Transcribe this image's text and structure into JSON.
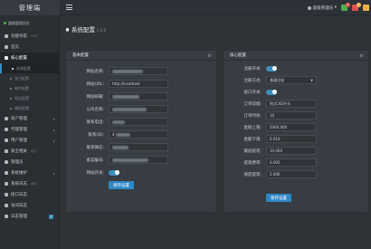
{
  "app": {
    "logo_text": "管理端"
  },
  "topbar": {
    "admin_label": "超级管理员",
    "admin_caret": "▾",
    "icons": [
      {
        "name": "bell-icon",
        "color": "#4cae4c",
        "badge": "2"
      },
      {
        "name": "message-icon",
        "color": "#d9534f",
        "badge": "4"
      },
      {
        "name": "user-icon",
        "color": "#f0ad4e",
        "badge": ""
      }
    ]
  },
  "sidebar": {
    "user_status": "超级管理员在",
    "items": [
      {
        "label": "功能导航",
        "tag": "HOT",
        "type": "section"
      },
      {
        "label": "首页",
        "type": "item"
      },
      {
        "label": "核心配置",
        "type": "item",
        "active": true
      },
      {
        "label": "系统配置",
        "type": "child",
        "selected": true
      },
      {
        "label": "支付配置",
        "type": "child"
      },
      {
        "label": "邮件配置",
        "type": "child"
      },
      {
        "label": "短信配置",
        "type": "child"
      },
      {
        "label": "模板配置",
        "type": "child"
      },
      {
        "label": "商户管理",
        "type": "item",
        "caret": "▸"
      },
      {
        "label": "代理管理",
        "type": "item",
        "caret": "▸"
      },
      {
        "label": "用户管理",
        "type": "item",
        "caret": "▸"
      },
      {
        "label": "安全相关",
        "tag": "核心",
        "type": "section"
      },
      {
        "label": "管理员",
        "type": "item"
      },
      {
        "label": "系统维护",
        "type": "item",
        "caret": "▸"
      },
      {
        "label": "系统日志",
        "tag": "调试",
        "type": "section"
      },
      {
        "label": "接口日志",
        "type": "item"
      },
      {
        "label": "访问日志",
        "type": "item"
      },
      {
        "label": "日志管理",
        "type": "item",
        "badge": "1"
      }
    ]
  },
  "page": {
    "title": "系统配置",
    "version": "v 2.0"
  },
  "basic_panel": {
    "title": "基本配置",
    "fields": [
      {
        "label": "网站名称:",
        "value": "",
        "blurred": true
      },
      {
        "label": "网站URL:",
        "value": "http://localhost"
      },
      {
        "label": "网站邮箱:",
        "value": "",
        "blurred": true
      },
      {
        "label": "公司名称:",
        "value": "",
        "blurred": true
      },
      {
        "label": "联系电话:",
        "value": "",
        "blurred": true
      },
      {
        "label": "联系QQ:",
        "value": "4",
        "blurred": true
      },
      {
        "label": "联系微信:",
        "value": "",
        "blurred": true
      },
      {
        "label": "备案编号:",
        "value": "",
        "blurred": true
      }
    ],
    "toggle_label": "网站开关:",
    "toggle_on": true,
    "save_label": "保存设置"
  },
  "core_panel": {
    "title": "核心配置",
    "reg_toggle_label": "注册开关:",
    "reg_toggle_on": true,
    "reg_mode_label": "注册方式:",
    "reg_mode_value": "普通注册",
    "api_toggle_label": "接口开关:",
    "api_toggle_on": true,
    "fields": [
      {
        "label": "订单前缀:",
        "value": "例:JCXD开头"
      },
      {
        "label": "订单时效:",
        "value": "10"
      },
      {
        "label": "金额上限:",
        "value": "5000.000"
      },
      {
        "label": "金额下限:",
        "value": "0.010"
      },
      {
        "label": "最低提现:",
        "value": "10.000"
      },
      {
        "label": "提现费率:",
        "value": "0.002"
      },
      {
        "label": "保底提现:",
        "value": "5.000"
      }
    ],
    "save_label": "保存设置"
  }
}
